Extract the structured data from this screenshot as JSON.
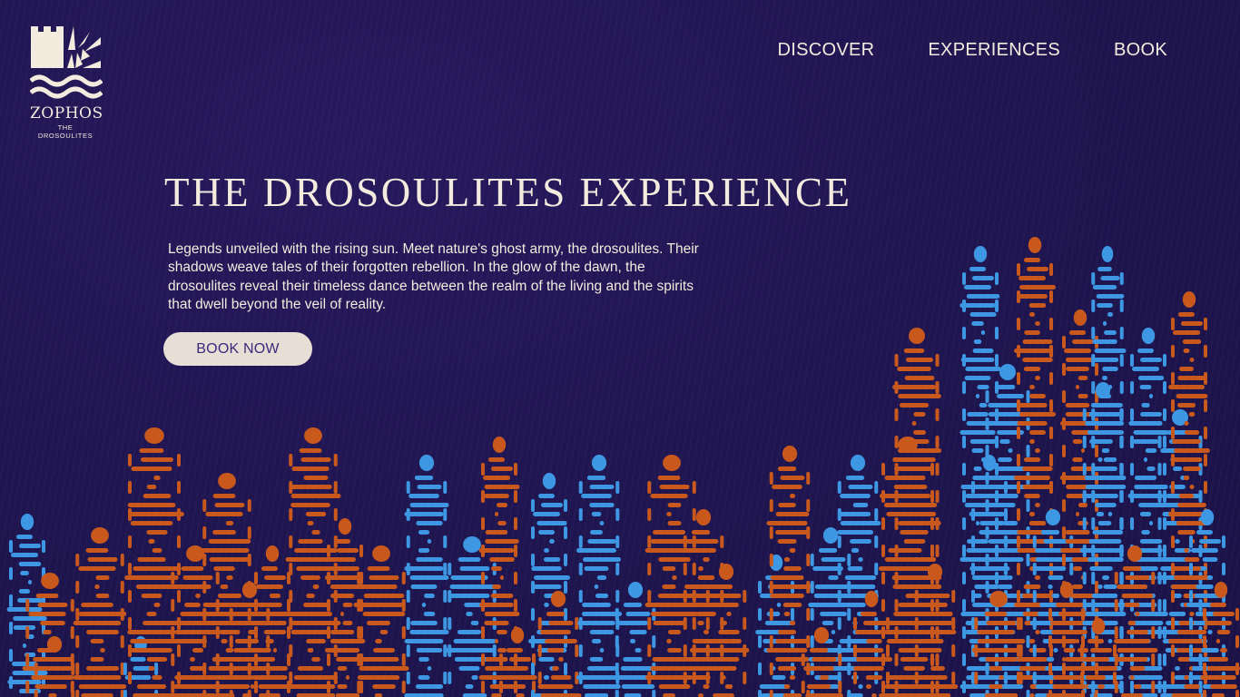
{
  "brand": {
    "name": "ZOPHOS",
    "tagline": "THE DROSOULITES",
    "logo_icon": "castle-sun-waves-icon"
  },
  "nav": {
    "items": [
      {
        "label": "DISCOVER"
      },
      {
        "label": "EXPERIENCES"
      },
      {
        "label": "BOOK"
      }
    ]
  },
  "hero": {
    "title": "THE DROSOULITES EXPERIENCE",
    "description": "Legends unveiled with the rising sun. Meet nature's ghost army, the drosoulites. Their shadows weave tales of their forgotten rebellion. In the glow of the dawn, the drosoulites reveal their timeless dance between the realm of the living and the spirits that dwell beyond the veil of reality.",
    "cta_label": "BOOK NOW"
  },
  "colors": {
    "background": "#1f1550",
    "cream": "#f3ebdd",
    "button_bg": "#e7dfd6",
    "button_text": "#3b2a7c",
    "figure_orange": "#c9581c",
    "figure_blue": "#3d97e3"
  }
}
